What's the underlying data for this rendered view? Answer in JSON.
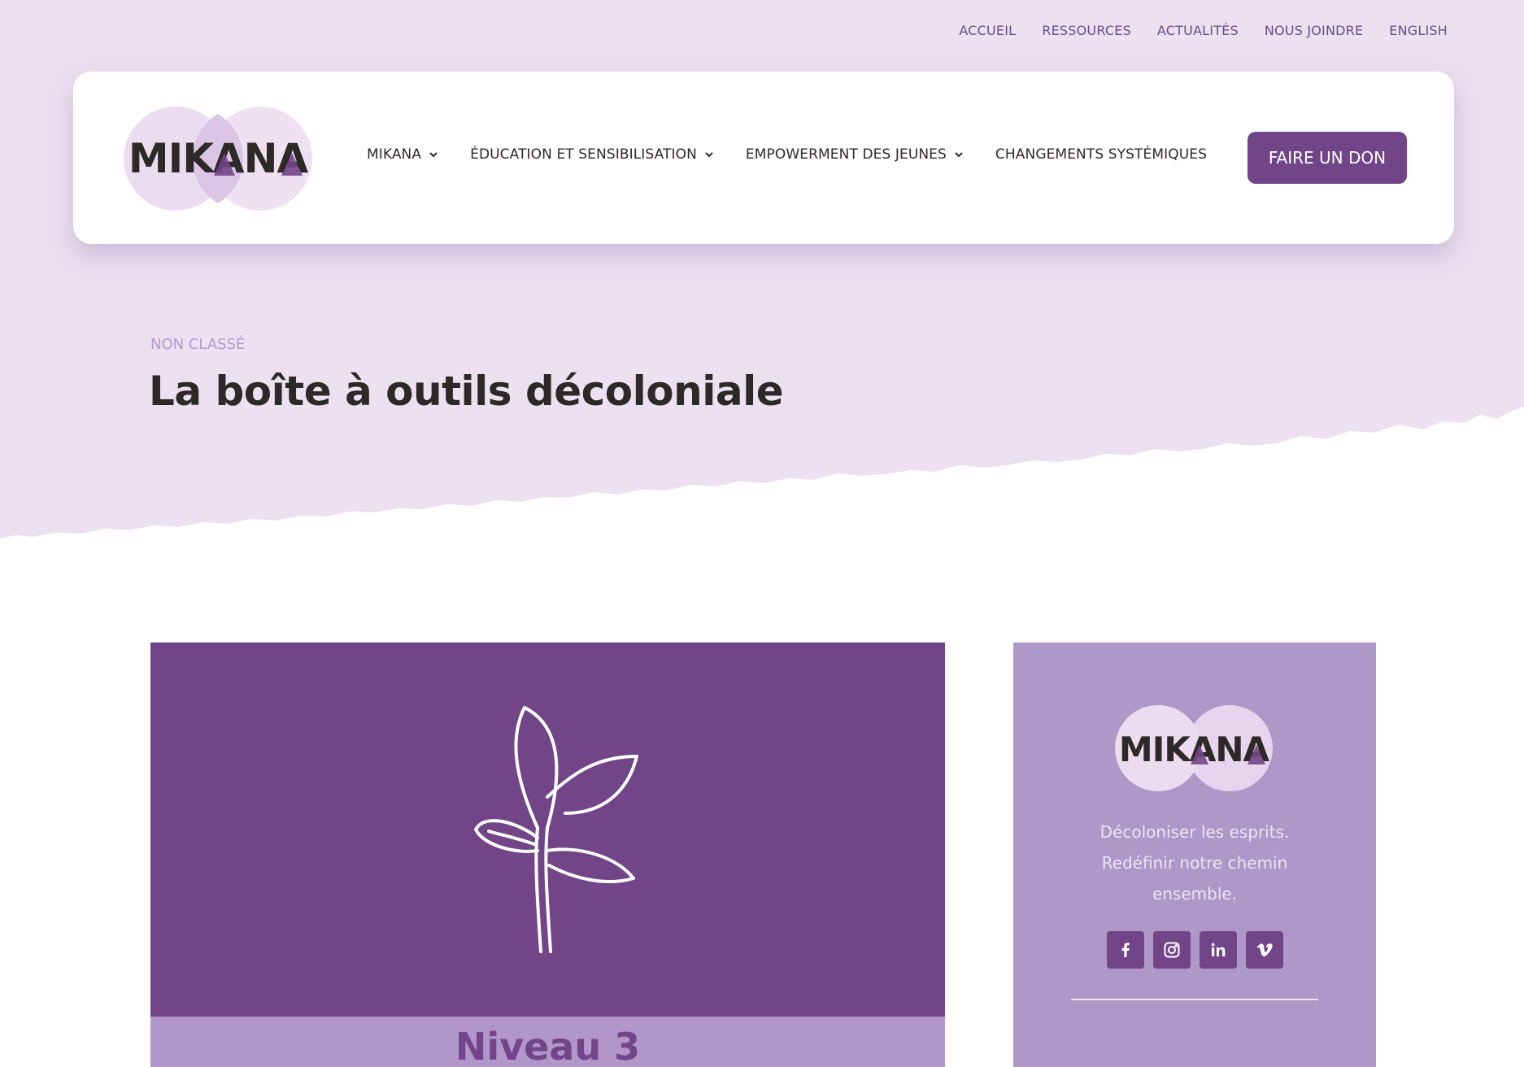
{
  "colors": {
    "hero_bg": "#ede0f1",
    "brand_purple": "#724588",
    "light_purple": "#b196c9",
    "sidebar_bg": "#ae98c8"
  },
  "top_nav": {
    "items": [
      "ACCUEIL",
      "RESSOURCES",
      "ACTUALITÉS",
      "NOUS JOINDRE",
      "ENGLISH"
    ]
  },
  "header": {
    "logo_text": "MIKANA",
    "nav": [
      {
        "label": "MIKANA",
        "has_dropdown": true
      },
      {
        "label": "ÉDUCATION ET SENSIBILISATION",
        "has_dropdown": true
      },
      {
        "label": "EMPOWERMENT DES JEUNES",
        "has_dropdown": true
      },
      {
        "label": "CHANGEMENTS SYSTÉMIQUES",
        "has_dropdown": false
      }
    ],
    "donate_label": "FAIRE UN DON"
  },
  "post": {
    "category": "NON CLASSÉ",
    "title": "La boîte à outils décoloniale"
  },
  "article_card": {
    "image_icon": "sprout-icon",
    "level_title": "Niveau 3"
  },
  "sidebar": {
    "logo_text": "MIKANA",
    "tagline_lines": [
      "Décoloniser les esprits.",
      "Redéfinir notre chemin",
      "ensemble."
    ],
    "social": [
      "facebook-icon",
      "instagram-icon",
      "linkedin-icon",
      "vimeo-icon"
    ]
  }
}
